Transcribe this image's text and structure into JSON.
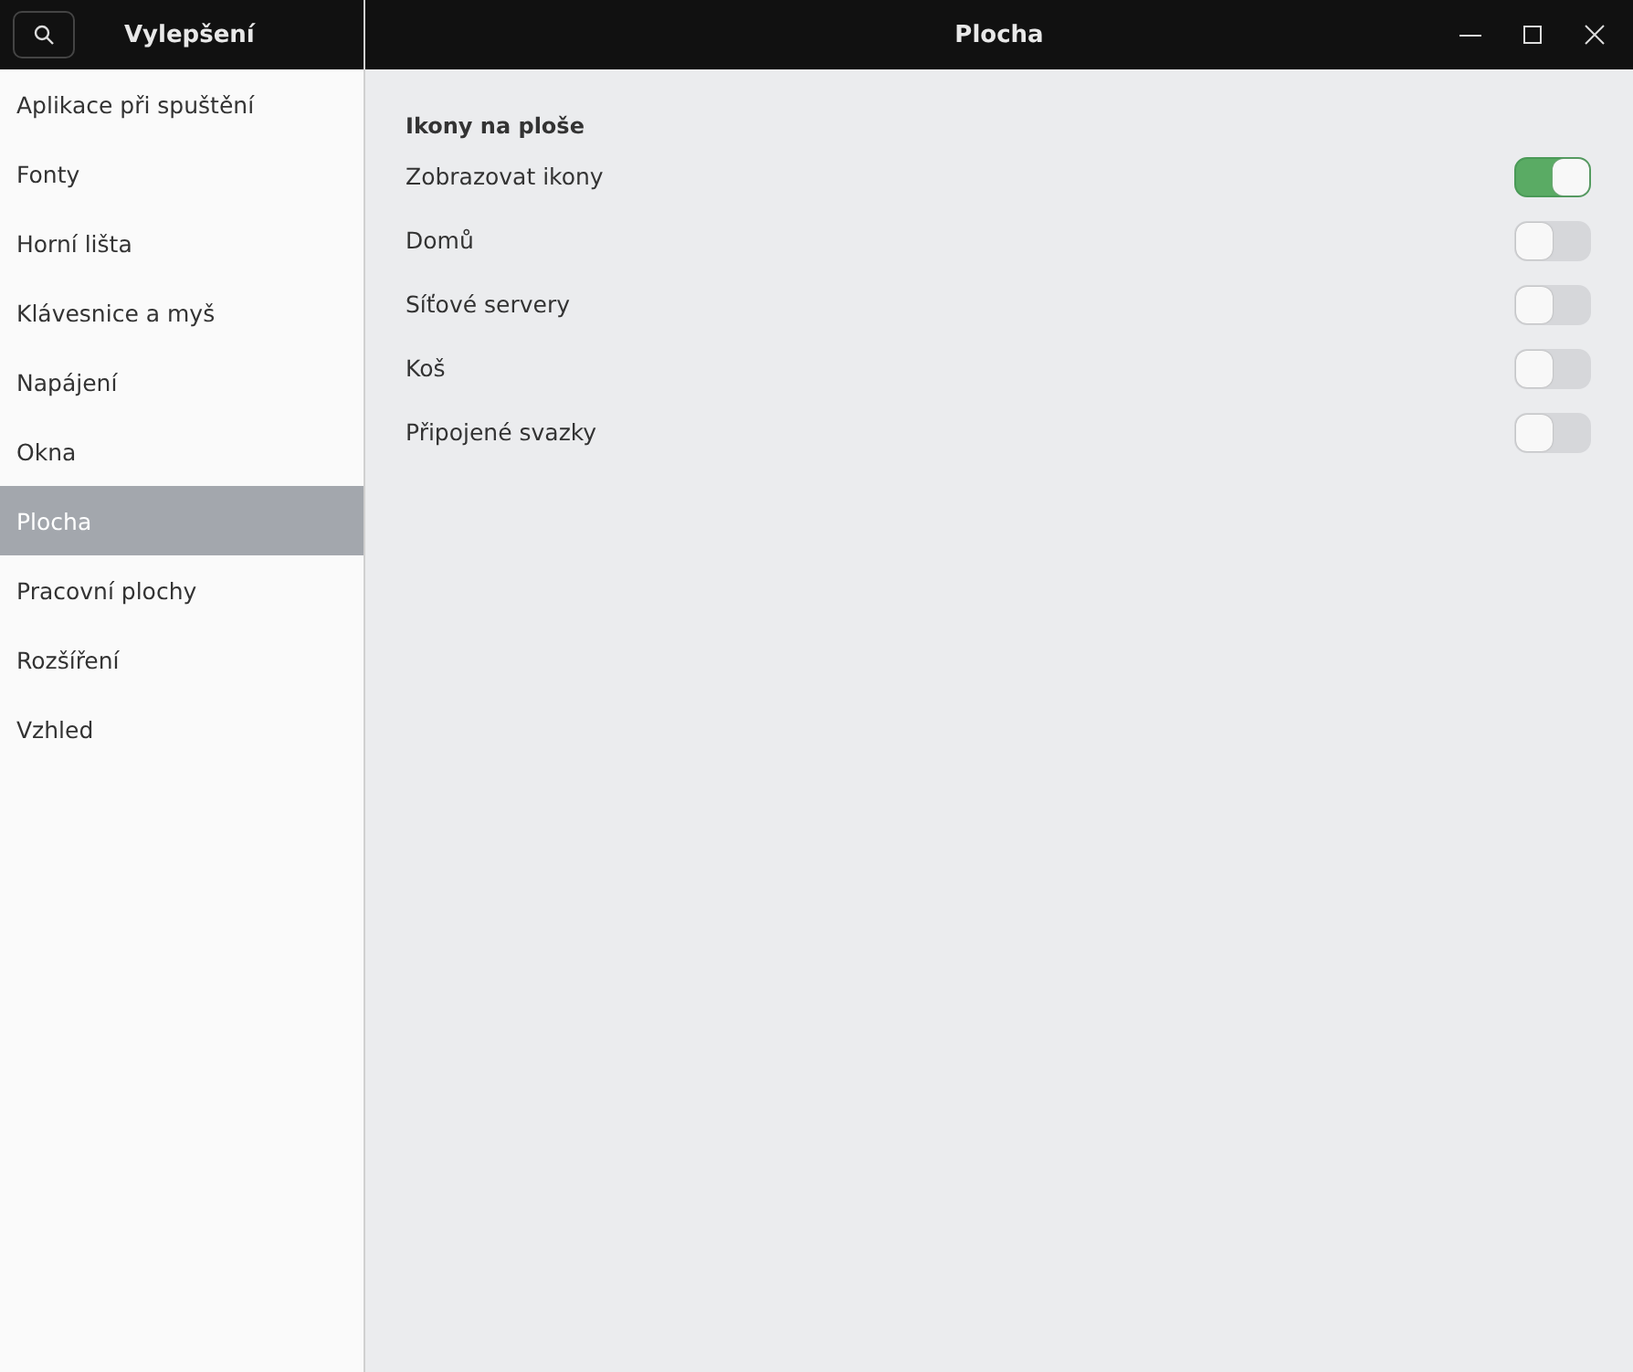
{
  "sidebar": {
    "title": "Vylepšení",
    "items": [
      {
        "label": "Aplikace při spuštění",
        "selected": false
      },
      {
        "label": "Fonty",
        "selected": false
      },
      {
        "label": "Horní lišta",
        "selected": false
      },
      {
        "label": "Klávesnice a myš",
        "selected": false
      },
      {
        "label": "Napájení",
        "selected": false
      },
      {
        "label": "Okna",
        "selected": false
      },
      {
        "label": "Plocha",
        "selected": true
      },
      {
        "label": "Pracovní plochy",
        "selected": false
      },
      {
        "label": "Rozšíření",
        "selected": false
      },
      {
        "label": "Vzhled",
        "selected": false
      }
    ]
  },
  "window": {
    "title": "Plocha"
  },
  "section": {
    "heading": "Ikony na ploše",
    "settings": [
      {
        "label": "Zobrazovat ikony",
        "on": true
      },
      {
        "label": "Domů",
        "on": false
      },
      {
        "label": "Síťové servery",
        "on": false
      },
      {
        "label": "Koš",
        "on": false
      },
      {
        "label": "Připojené svazky",
        "on": false
      }
    ]
  }
}
